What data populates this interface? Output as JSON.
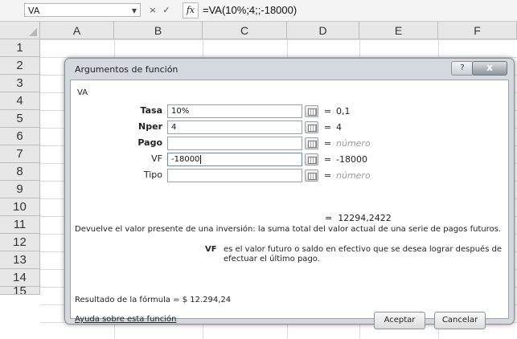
{
  "formula_bar": {
    "name_box": "VA",
    "cancel_symbol": "×",
    "enter_symbol": "✓",
    "fx_label": "fx",
    "formula": "=VA(10%;4;;-18000)"
  },
  "columns": [
    "A",
    "B",
    "C",
    "D",
    "E",
    "F"
  ],
  "rows": [
    "1",
    "2",
    "3",
    "4",
    "5",
    "6",
    "7",
    "8",
    "9",
    "10",
    "11",
    "12",
    "13",
    "14",
    "15"
  ],
  "dialog": {
    "title": "Argumentos de función",
    "help_symbol": "?",
    "close_symbol": "x",
    "function_name": "VA",
    "args": [
      {
        "label": "Tasa",
        "bold": true,
        "input": "10%",
        "value": "0,1",
        "placeholder": false
      },
      {
        "label": "Nper",
        "bold": true,
        "input": "4",
        "value": "4",
        "placeholder": false
      },
      {
        "label": "Pago",
        "bold": true,
        "input": "",
        "value": "número",
        "placeholder": true
      },
      {
        "label": "VF",
        "bold": false,
        "input": "-18000",
        "value": "-18000",
        "placeholder": false
      },
      {
        "label": "Tipo",
        "bold": false,
        "input": "",
        "value": "número",
        "placeholder": true
      }
    ],
    "equals": "=",
    "result_value": "12294,2422",
    "description": "Devuelve el valor presente de una inversión: la suma total del valor actual de una serie de pagos futuros.",
    "arg_help_name": "VF",
    "arg_help_text": "es el valor futuro o saldo en efectivo que se desea lograr después de efectuar el último pago.",
    "formula_result": "Resultado de la fórmula =  $ 12.294,24",
    "help_link": "Ayuda sobre esta función",
    "ok_label": "Aceptar",
    "cancel_label": "Cancelar"
  }
}
